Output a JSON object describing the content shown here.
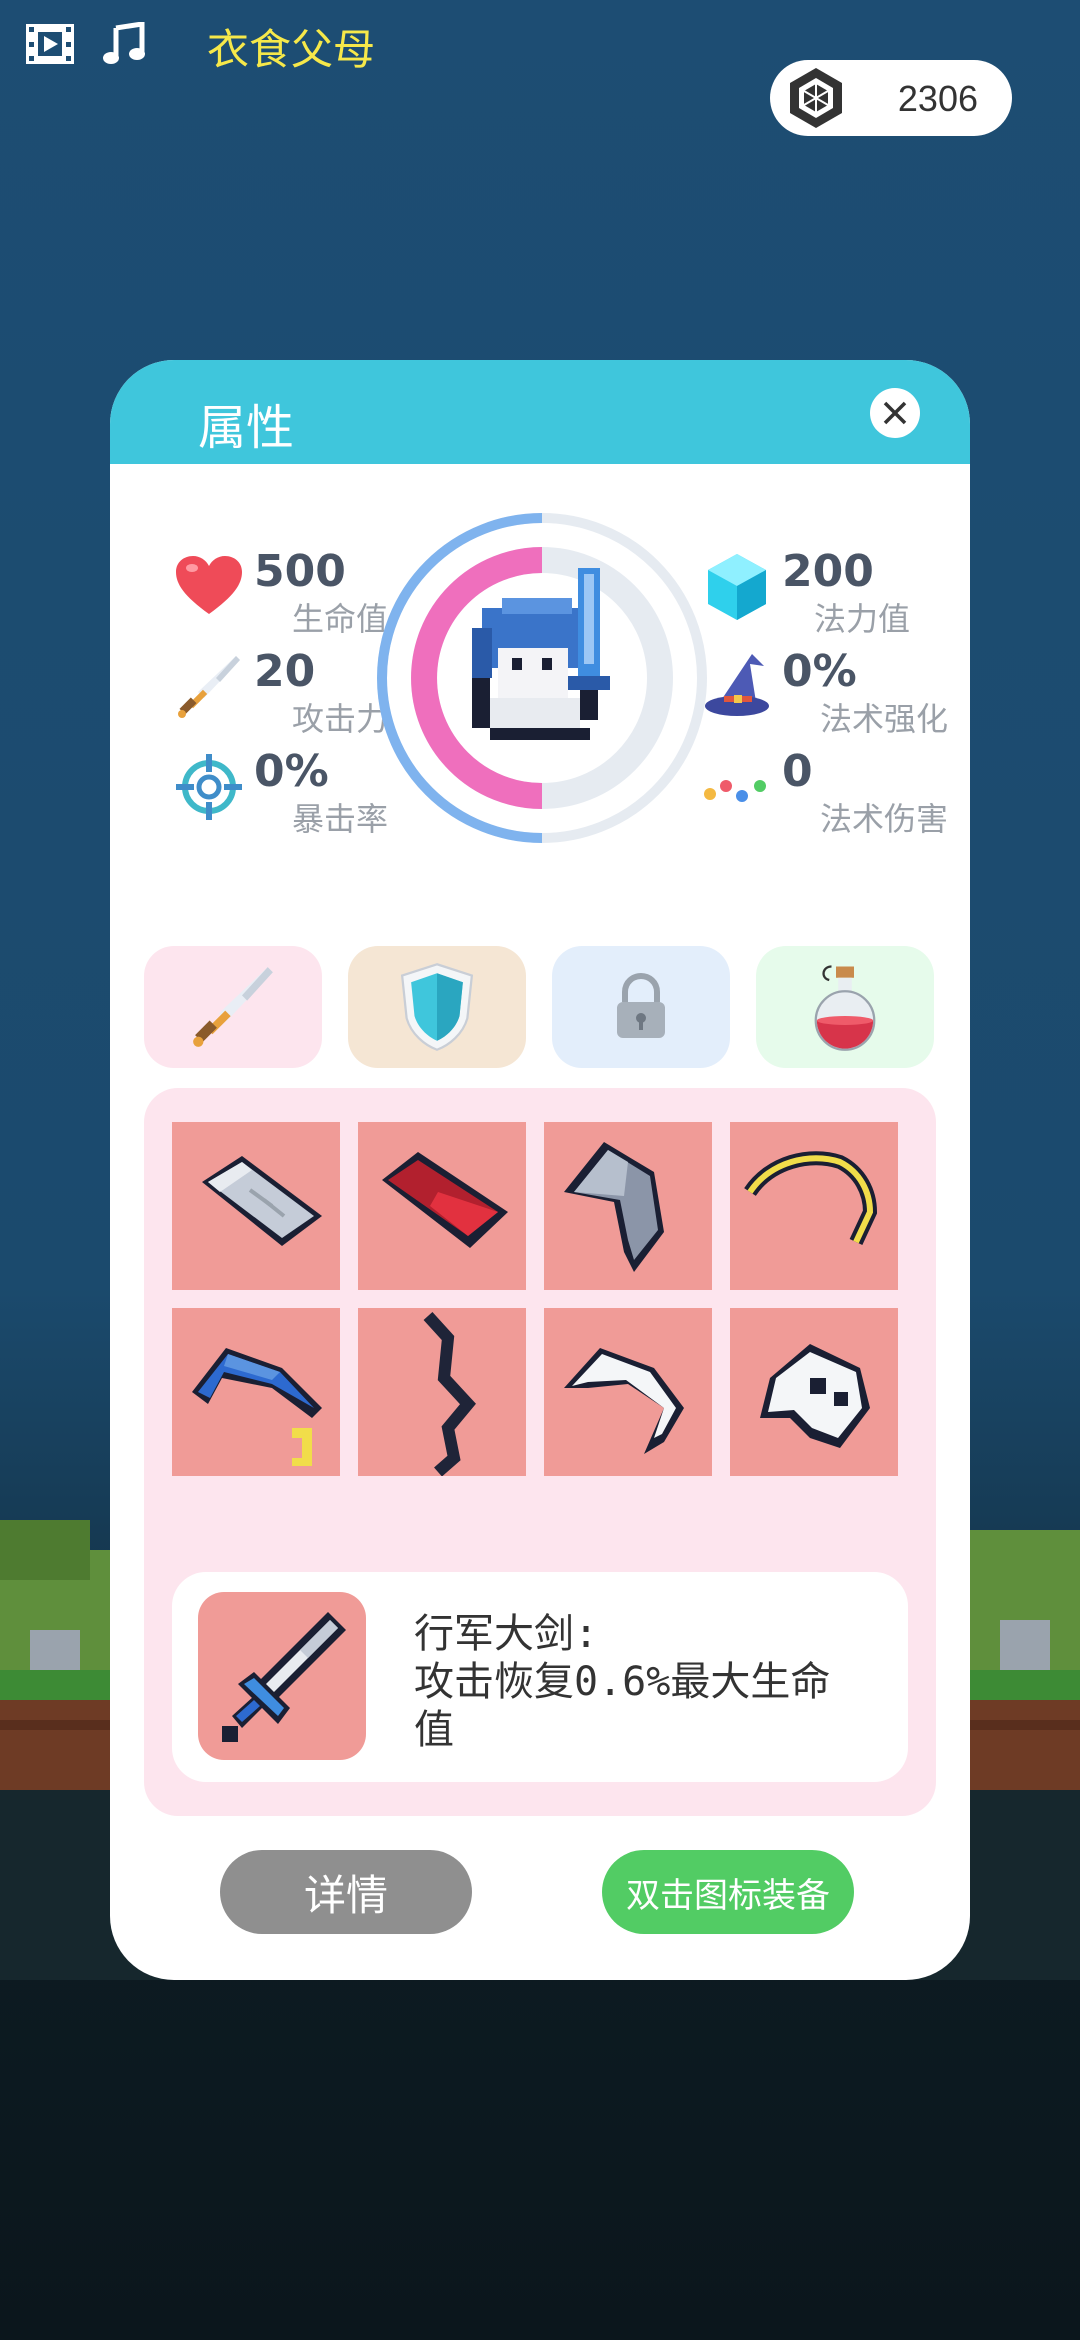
{
  "topbar": {
    "video_icon": "film-icon",
    "music_icon": "music-note-icon",
    "title": "衣食父母",
    "currency": {
      "icon": "hexagon-gem-icon",
      "amount": "2306"
    }
  },
  "panel": {
    "title": "属性",
    "close_icon": "close-icon",
    "stats_left": [
      {
        "icon": "heart-icon",
        "value": "500",
        "label": "生命值"
      },
      {
        "icon": "sword-icon",
        "value": "20",
        "label": "攻击力"
      },
      {
        "icon": "crosshair-icon",
        "value": "0%",
        "label": "暴击率"
      }
    ],
    "stats_right": [
      {
        "icon": "crystal-icon",
        "value": "200",
        "label": "法力值"
      },
      {
        "icon": "wizard-hat-icon",
        "value": "0%",
        "label": "法术强化"
      },
      {
        "icon": "dots-icon",
        "value": "0",
        "label": "法术伤害"
      }
    ],
    "rings": {
      "outer_fraction": 0.5,
      "inner_fraction": 0.5,
      "outer_color": "#7fb3ee",
      "inner_color": "#ef6fbd"
    },
    "tabs": [
      {
        "name": "weapon",
        "icon": "sword-icon",
        "color": "#fde5ee"
      },
      {
        "name": "armor",
        "icon": "shield-icon",
        "color": "#f5e6d4"
      },
      {
        "name": "locked",
        "icon": "lock-icon",
        "color": "#e3eefb"
      },
      {
        "name": "potion",
        "icon": "potion-icon",
        "color": "#e6fbeb"
      }
    ],
    "inventory": [
      "bandage-item-icon",
      "red-book-item-icon",
      "gray-axe-item-icon",
      "golden-bow-item-icon",
      "blue-scythe-item-icon",
      "dark-whip-item-icon",
      "white-boomerang-item-icon",
      "skull-item-icon"
    ],
    "detail": {
      "icon": "great-sword-icon",
      "text": "行军大剑:\n攻击恢复0.6%最大生命值"
    },
    "buttons": {
      "detail": "详情",
      "equip": "双击图标装备"
    }
  }
}
